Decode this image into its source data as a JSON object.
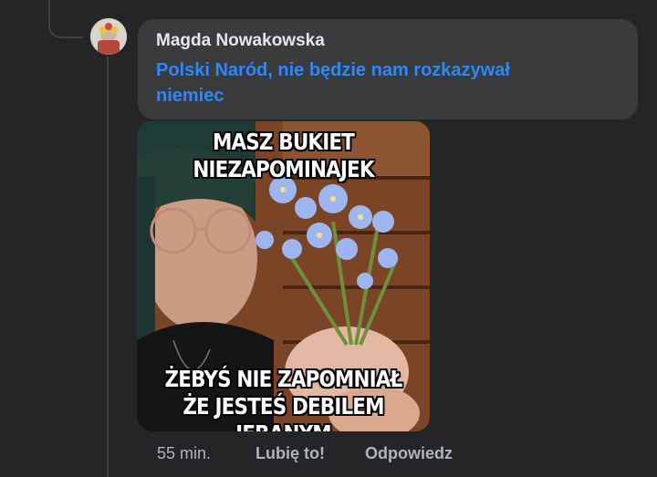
{
  "comment": {
    "author": "Magda Nowakowska",
    "text": "Polski Naród, nie będzie nam rozkazywał niemiec",
    "text_color": "#2d88ff"
  },
  "meme": {
    "top_line_1": "MASZ BUKIET",
    "top_line_2": "NIEZAPOMINAJEK",
    "bottom_line_1": "ŻEBYŚ NIE ZAPOMNIAŁ",
    "bottom_line_2": "ŻE JESTEŚ DEBILEM JEBANYM"
  },
  "actions": {
    "time": "55 min.",
    "like_label": "Lubię to!",
    "reply_label": "Odpowiedz"
  },
  "colors": {
    "background": "#242526",
    "bubble": "#3a3b3c",
    "secondary_text": "#b0b3b8"
  }
}
